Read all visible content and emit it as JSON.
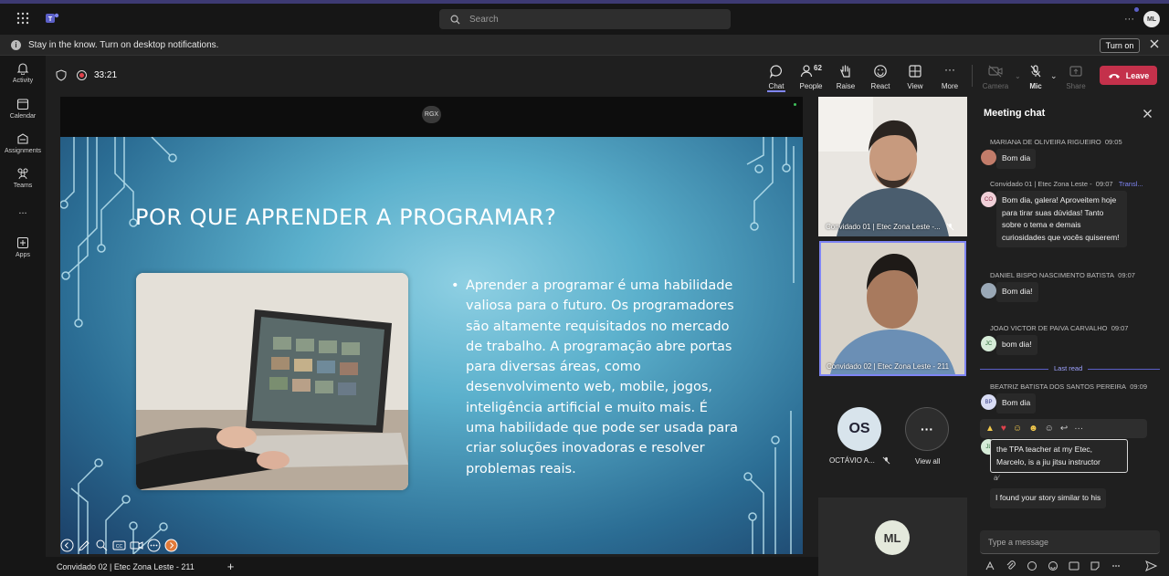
{
  "search": {
    "placeholder": "Search"
  },
  "profile_initials": "ML",
  "notification": {
    "text": "Stay in the know. Turn on desktop notifications.",
    "button": "Turn on"
  },
  "rail": [
    {
      "label": "Activity"
    },
    {
      "label": "Calendar"
    },
    {
      "label": "Assignments"
    },
    {
      "label": "Teams"
    },
    {
      "label": "..."
    },
    {
      "label": "Apps"
    }
  ],
  "meeting": {
    "timer": "33:21"
  },
  "toolbar": {
    "chat": "Chat",
    "people": "People",
    "people_count": "62",
    "raise": "Raise",
    "react": "React",
    "view": "View",
    "more": "More",
    "camera": "Camera",
    "mic": "Mic",
    "share": "Share",
    "leave": "Leave"
  },
  "slide": {
    "badge": "RGX",
    "title": "POR QUE APRENDER A PROGRAMAR?",
    "body": "Aprender a programar é uma habilidade valiosa para o futuro. Os programadores são altamente requisitados no mercado de trabalho. A programação abre portas para diversas áreas, como desenvolvimento web, mobile, jogos, inteligência artificial e muito mais. É uma habilidade que pode ser usada para criar soluções inovadoras e resolver problemas reais."
  },
  "presenter_label": "Convidado 02 | Etec Zona Leste - 211",
  "participants": {
    "tile1": "Convidado 01 | Etec Zona Leste -...",
    "tile2": "Convidado 02 | Etec Zona Leste - 211",
    "os_initials": "OS",
    "os_name": "OCTÁVIO A...",
    "view_all": "View all",
    "ml_initials": "ML"
  },
  "chat": {
    "title": "Meeting chat",
    "messages": [
      {
        "author": "MARIANA DE OLIVEIRA RIGUEIRO",
        "time": "09:05",
        "text": "Bom dia"
      },
      {
        "author": "Convidado 01 | Etec Zona Leste -",
        "time": "09:07",
        "extra": "Transl...",
        "initials": "CO",
        "text": "Bom dia, galera! Aproveitem hoje para tirar suas dúvidas! Tanto sobre o tema e demais curiosidades que vocês quiserem!"
      },
      {
        "author": "DANIEL BISPO NASCIMENTO BATISTA",
        "time": "09:07",
        "text": "Bom dia!"
      },
      {
        "author": "JOAO VICTOR DE PAIVA CARVALHO",
        "time": "09:07",
        "initials": "JC",
        "text": "bom dia!"
      },
      {
        "author": "BEATRIZ BATISTA DOS SANTOS PEREIRA",
        "time": "09:09",
        "initials": "BP",
        "text": "Bom dia"
      },
      {
        "text": "the TPA teacher at my Etec, Marcelo, is a jiu jitsu instructor",
        "initials": "JL"
      },
      {
        "text": "I found your story similar to his"
      }
    ],
    "last_read": "Last read",
    "input_placeholder": "Type a message"
  }
}
